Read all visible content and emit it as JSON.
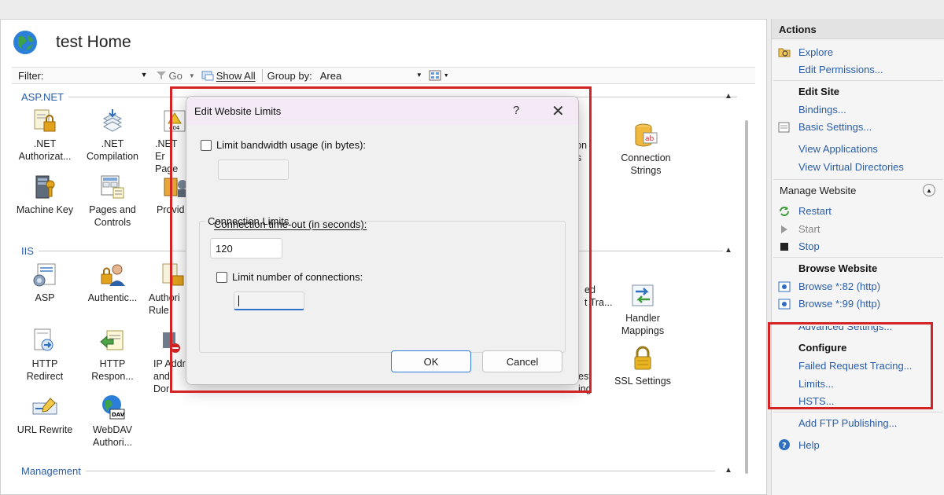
{
  "main": {
    "title": "test Home",
    "filter_label": "Filter:",
    "go_label": "Go",
    "show_all_label": "Show All",
    "group_by_label": "Group by:",
    "group_by_value": "Area",
    "sections": {
      "aspnet": "ASP.NET",
      "iis": "IIS",
      "management": "Management"
    },
    "features": {
      "net_authorization": ".NET\nAuthorizat...",
      "net_compilation": ".NET\nCompilation",
      "net_error_pages": ".NET Er\nPage",
      "machine_key": "Machine Key",
      "pages_controls": "Pages and\nControls",
      "providers": "Provid",
      "asp": "ASP",
      "authentication": "Authentic...",
      "authorization_rules": "Authori\nRule",
      "http_redirect": "HTTP\nRedirect",
      "http_response": "HTTP\nRespon...",
      "ip_address": "IP Addr\nand Dor",
      "url_rewrite": "URL Rewrite",
      "webdav": "WebDAV\nAuthori...",
      "configuration_partial": "ation\nngs",
      "connection_strings": "Connection\nStrings",
      "failed_partial": "ed\nt Tra...",
      "handler_mappings": "Handler\nMappings",
      "request_partial": "est\ning",
      "ssl_settings": "SSL Settings"
    }
  },
  "actions": {
    "header": "Actions",
    "explore": "Explore",
    "edit_permissions": "Edit Permissions...",
    "edit_site": "Edit Site",
    "bindings": "Bindings...",
    "basic_settings": "Basic Settings...",
    "view_applications": "View Applications",
    "view_virtual_directories": "View Virtual Directories",
    "manage_website": "Manage Website",
    "restart": "Restart",
    "start": "Start",
    "stop": "Stop",
    "browse_website": "Browse Website",
    "browse_82": "Browse *:82 (http)",
    "browse_99": "Browse *:99 (http)",
    "advanced_settings": "Advanced Settings...",
    "configure": "Configure",
    "failed_request_tracing": "Failed Request Tracing...",
    "limits": "Limits...",
    "hsts": "HSTS...",
    "add_ftp_publishing": "Add FTP Publishing...",
    "help": "Help"
  },
  "dialog": {
    "title": "Edit Website Limits",
    "help_glyph": "?",
    "close_glyph": "✕",
    "limit_bandwidth_label": "Limit bandwidth usage (in bytes):",
    "limit_bandwidth_value": "",
    "connection_limits_group": "Connection Limits",
    "connection_timeout_label": "Connection time-out (in seconds):",
    "connection_timeout_value": "120",
    "limit_connections_label": "Limit number of connections:",
    "limit_connections_value": "",
    "ok_label": "OK",
    "cancel_label": "Cancel"
  },
  "colors": {
    "link_blue": "#2a5da8",
    "highlight_red": "#d32325",
    "dialog_titlebar": "#f3eaf6"
  }
}
